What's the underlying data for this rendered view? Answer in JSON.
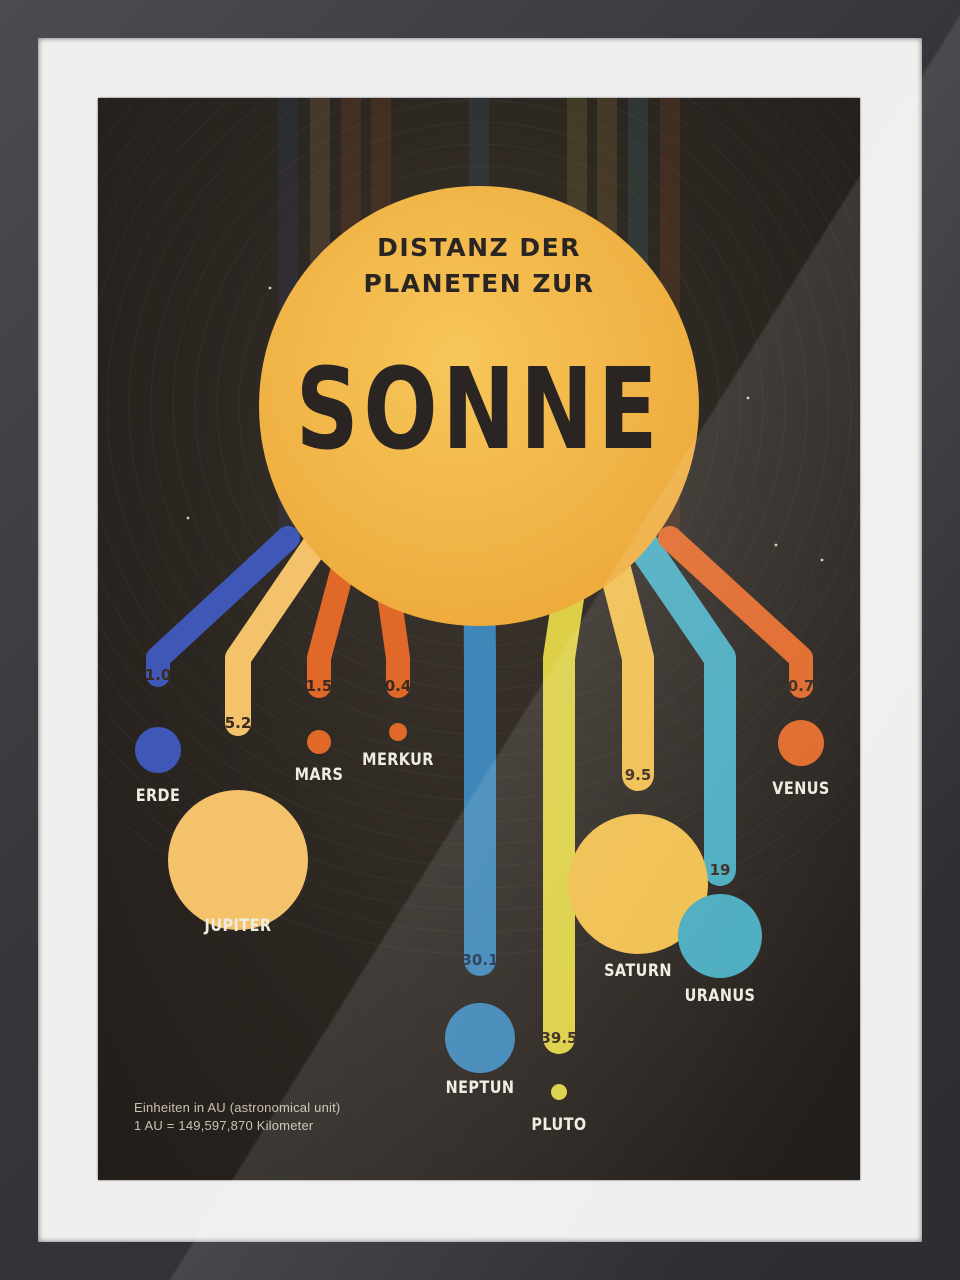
{
  "poster": {
    "title_line1": "DISTANZ DER",
    "title_line2": "PLANETEN ZUR",
    "title_main": "SONNE",
    "footnote_line1": "Einheiten in AU (astronomical unit)",
    "footnote_line2": "1 AU = 149,597,870 Kilometer"
  },
  "colors": {
    "background": "#2a241f",
    "sun": "#f2b84b",
    "title_text": "#2a2522",
    "label_text": "#f1ece2",
    "value_text": "#3a302a"
  },
  "chart_data": {
    "type": "bar",
    "title": "DISTANZ DER PLANETEN ZUR SONNE",
    "unit": "AU",
    "categories": [
      "ERDE",
      "JUPITER",
      "MARS",
      "MERKUR",
      "NEPTUN",
      "PLUTO",
      "SATURN",
      "URANUS",
      "VENUS"
    ],
    "values": [
      1.0,
      5.2,
      1.5,
      0.4,
      30.1,
      39.5,
      9.5,
      19,
      0.7
    ],
    "value_labels": [
      "1.0",
      "5.2",
      "1.5",
      "0.4",
      "30.1",
      "39.5",
      "9.5",
      "19",
      "0.7"
    ],
    "series_colors": [
      "#3f58b8",
      "#f3c26a",
      "#e0692a",
      "#e0692a",
      "#3f87b8",
      "#ddd046",
      "#f0bf4e",
      "#4bacc0",
      "#e0692a"
    ]
  }
}
